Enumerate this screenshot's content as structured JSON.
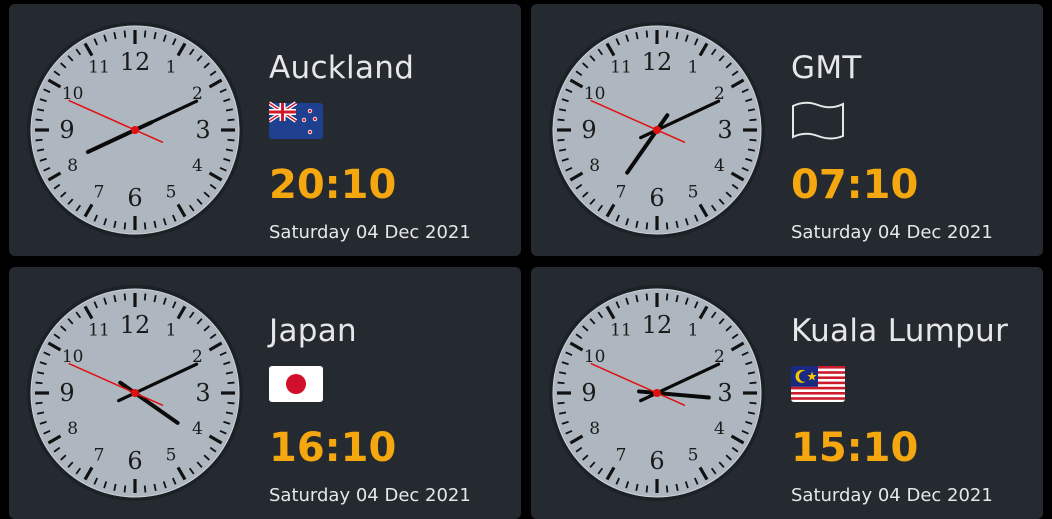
{
  "accent_color": "#f5a70f",
  "clocks": [
    {
      "city": "Auckland",
      "flag_icon": "new-zealand-flag-icon",
      "time": "20:10",
      "date": "Saturday 04 Dec 2021",
      "hour": 20,
      "minute": 10,
      "second": 49
    },
    {
      "city": "GMT",
      "flag_icon": "blank-white-flag-icon",
      "time": "07:10",
      "date": "Saturday 04 Dec 2021",
      "hour": 7,
      "minute": 10,
      "second": 49
    },
    {
      "city": "Japan",
      "flag_icon": "japan-flag-icon",
      "time": "16:10",
      "date": "Saturday 04 Dec 2021",
      "hour": 16,
      "minute": 10,
      "second": 49
    },
    {
      "city": "Kuala Lumpur",
      "flag_icon": "malaysia-flag-icon",
      "time": "15:10",
      "date": "Saturday 04 Dec 2021",
      "hour": 15,
      "minute": 10,
      "second": 49
    }
  ]
}
